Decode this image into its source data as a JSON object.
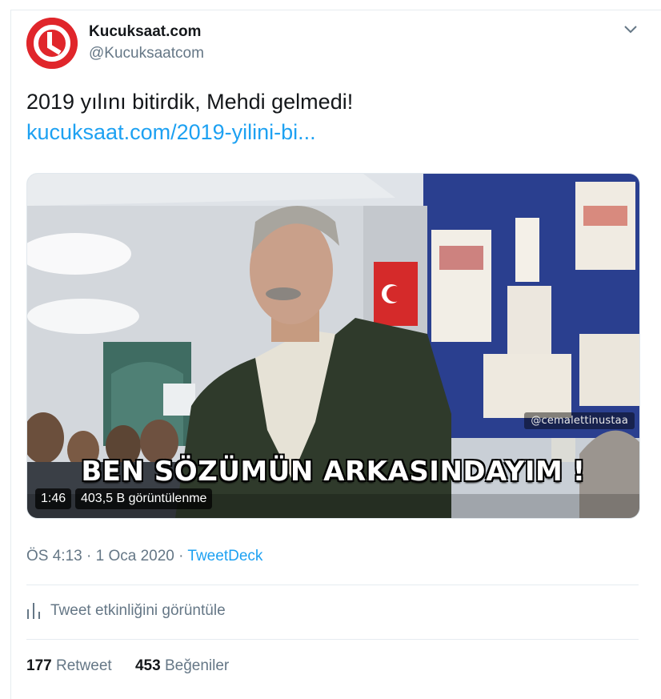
{
  "author": {
    "display_name": "Kucuksaat.com",
    "handle": "@Kucuksaatcom",
    "avatar_icon": "clock-logo-icon",
    "brand_color": "#e0262b"
  },
  "tweet": {
    "text": "2019 yılını bitirdik, Mehdi gelmedi!",
    "link": "kucuksaat.com/2019-yilini-bi..."
  },
  "media": {
    "watermark": "@cemalettinustaa",
    "subtitle": "BEN SÖZÜMÜN ARKASINDAYIM !",
    "duration": "1:46",
    "views": "403,5 B görüntülenme"
  },
  "meta": {
    "time": "ÖS 4:13",
    "date": "1 Oca 2020",
    "separator": "·",
    "source": "TweetDeck"
  },
  "activity": {
    "label": "Tweet etkinliğini görüntüle",
    "icon": "bar-chart-icon"
  },
  "stats": {
    "retweets_count": "177",
    "retweets_label": "Retweet",
    "likes_count": "453",
    "likes_label": "Beğeniler"
  },
  "colors": {
    "link": "#1da1f2",
    "secondary_text": "#657786",
    "primary_text": "#14171a"
  }
}
